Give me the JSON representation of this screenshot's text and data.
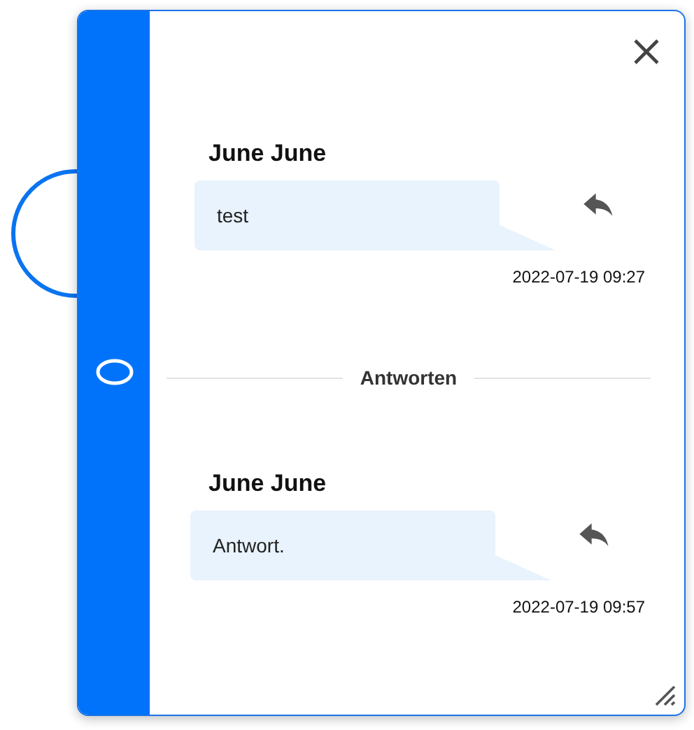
{
  "comment": {
    "author": "June June",
    "text": "test",
    "timestamp": "2022-07-19 09:27"
  },
  "replies_divider": "Antworten",
  "replies": [
    {
      "author": "June June",
      "text": "Antwort.",
      "timestamp": "2022-07-19 09:57"
    }
  ]
}
